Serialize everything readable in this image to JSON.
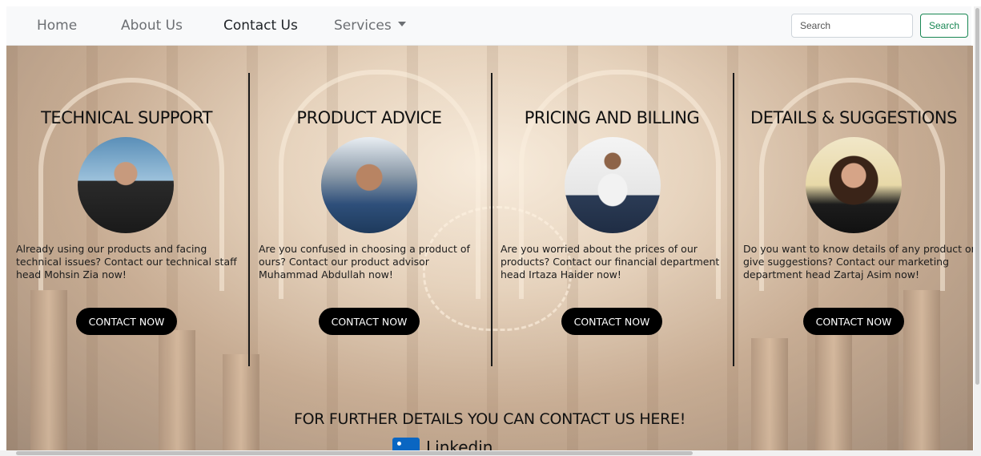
{
  "navbar": {
    "links": [
      {
        "label": "Home"
      },
      {
        "label": "About Us"
      },
      {
        "label": "Contact Us"
      },
      {
        "label": "Services"
      }
    ],
    "search_placeholder": "Search",
    "search_button": "Search"
  },
  "cards": [
    {
      "title": "TECHNICAL SUPPORT",
      "description": "Already using our products and facing technical issues? Contact our technical staff head Mohsin Zia now!",
      "button": "CONTACT NOW"
    },
    {
      "title": "PRODUCT ADVICE",
      "description": "Are you confused in choosing a product of ours? Contact our product advisor Muhammad Abdullah now!",
      "button": "CONTACT NOW"
    },
    {
      "title": "PRICING AND BILLING",
      "description": "Are you worried about the prices of our products? Contact our financial department head Irtaza Haider now!",
      "button": "CONTACT NOW"
    },
    {
      "title": "DETAILS & SUGGESTIONS",
      "description": "Do you want to know details of any product or give suggestions? Contact our marketing department head Zartaj Asim now!",
      "button": "CONTACT NOW"
    }
  ],
  "further_heading": "FOR FURTHER DETAILS YOU CAN CONTACT US HERE!",
  "social": {
    "partial_label": "Linkedin",
    "icon": "linkedin-icon",
    "icon_color": "#0a66c2"
  },
  "colors": {
    "search_button": "#198754",
    "cta_background": "#000000",
    "divider": "#1a1a1a"
  }
}
